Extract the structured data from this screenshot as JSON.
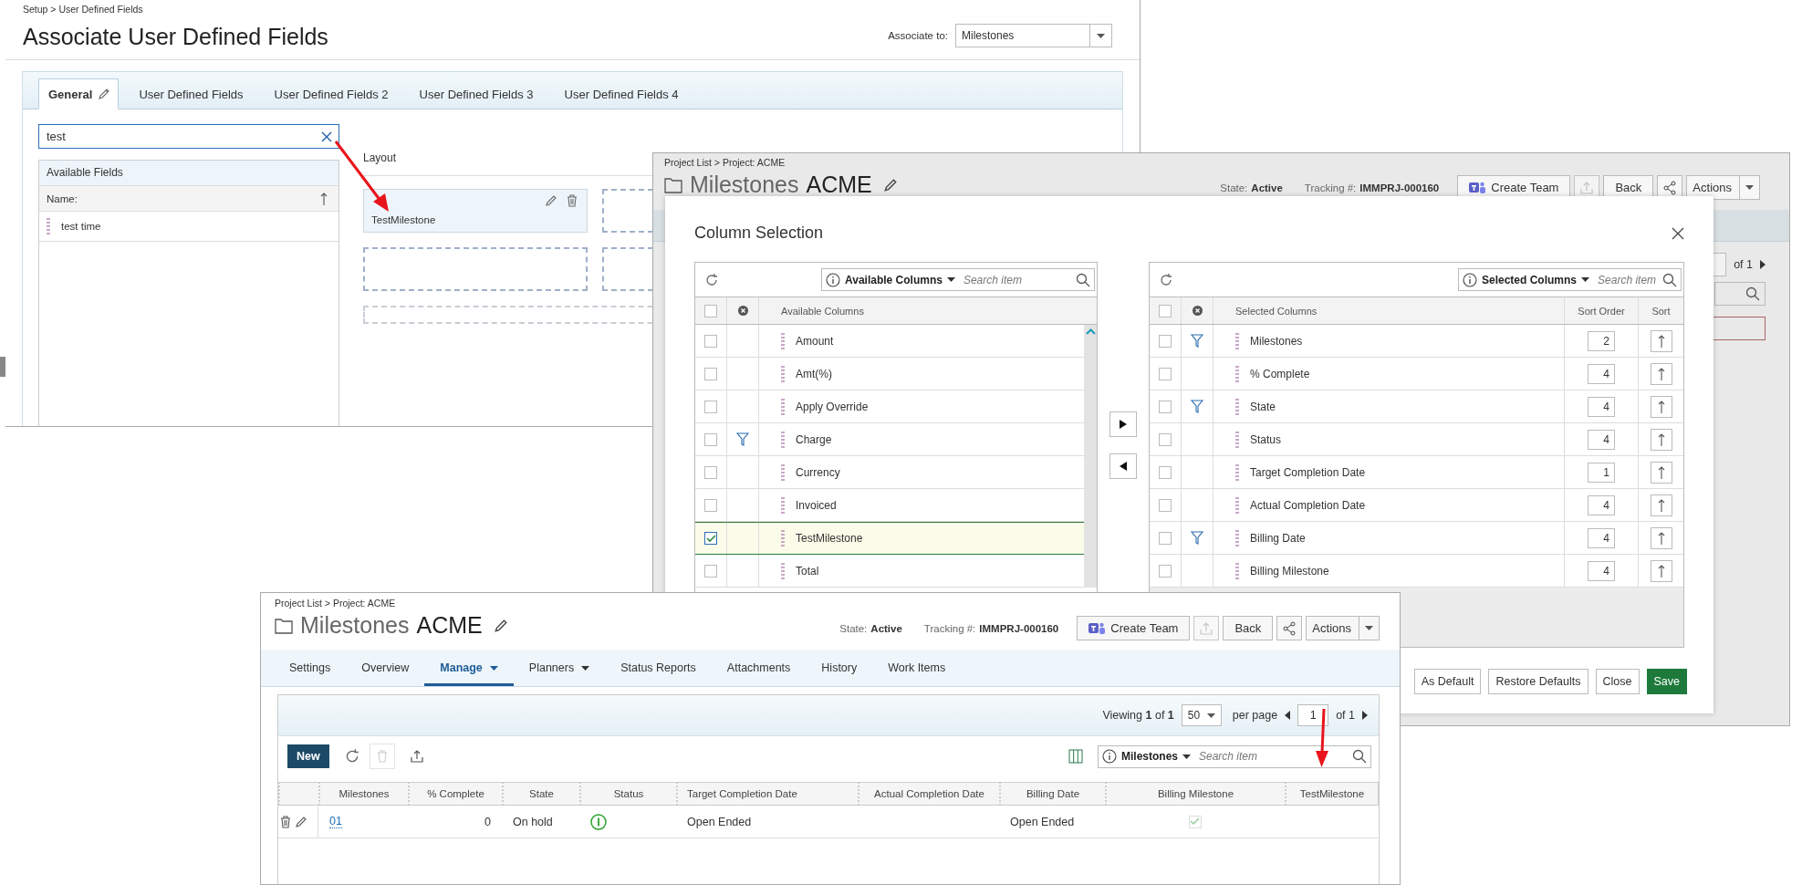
{
  "setup_page": {
    "breadcrumb": "Setup > User Defined Fields",
    "title": "Associate User Defined Fields",
    "associate_label": "Associate to:",
    "associate_value": "Milestones",
    "tabs": [
      {
        "label": "General",
        "selected": true
      },
      {
        "label": "User Defined Fields",
        "selected": false
      },
      {
        "label": "User Defined Fields 2",
        "selected": false
      },
      {
        "label": "User Defined Fields 3",
        "selected": false
      },
      {
        "label": "User Defined Fields 4",
        "selected": false
      }
    ],
    "search": {
      "value": "test"
    },
    "available_fields": {
      "title": "Available Fields",
      "column": "Name:",
      "items": [
        "test time"
      ]
    },
    "layout": {
      "title": "Layout",
      "fields": [
        "TestMilestone"
      ]
    }
  },
  "project_page_back": {
    "breadcrumb": "Project List > Project: ACME",
    "title": "Milestones",
    "project": "ACME",
    "state_label": "State:",
    "state": "Active",
    "tracking_label": "Tracking #:",
    "tracking": "IMMPRJ-000160",
    "create_team": "Create Team",
    "back": "Back",
    "actions": "Actions",
    "pager_of": "of 1"
  },
  "column_selection": {
    "title": "Column Selection",
    "available": {
      "dropdown": "Available Columns",
      "placeholder": "Search item",
      "header": "Available Columns",
      "all_checked": false,
      "rows": [
        {
          "name": "Amount",
          "checked": false,
          "filter": false
        },
        {
          "name": "Amt(%)",
          "checked": false,
          "filter": false
        },
        {
          "name": "Apply Override",
          "checked": false,
          "filter": false
        },
        {
          "name": "Charge",
          "checked": false,
          "filter": true
        },
        {
          "name": "Currency",
          "checked": false,
          "filter": false
        },
        {
          "name": "Invoiced",
          "checked": false,
          "filter": false
        },
        {
          "name": "TestMilestone",
          "checked": true,
          "filter": false
        },
        {
          "name": "Total",
          "checked": false,
          "filter": false
        }
      ]
    },
    "selected": {
      "dropdown": "Selected Columns",
      "placeholder": "Search item",
      "header": "Selected Columns",
      "all_checked": false,
      "sort_order_header": "Sort Order",
      "sort_header": "Sort",
      "rows": [
        {
          "name": "Milestones",
          "checked": false,
          "filter": true,
          "sort_order": "2"
        },
        {
          "name": "% Complete",
          "checked": false,
          "filter": false,
          "sort_order": "4"
        },
        {
          "name": "State",
          "checked": false,
          "filter": true,
          "sort_order": "4"
        },
        {
          "name": "Status",
          "checked": false,
          "filter": false,
          "sort_order": "4"
        },
        {
          "name": "Target Completion Date",
          "checked": false,
          "filter": false,
          "sort_order": "1"
        },
        {
          "name": "Actual Completion Date",
          "checked": false,
          "filter": false,
          "sort_order": "4"
        },
        {
          "name": "Billing Date",
          "checked": false,
          "filter": true,
          "sort_order": "4"
        },
        {
          "name": "Billing Milestone",
          "checked": false,
          "filter": false,
          "sort_order": "4"
        }
      ]
    },
    "buttons": [
      {
        "label": "As Default",
        "kind": "default"
      },
      {
        "label": "Restore Defaults",
        "kind": "default"
      },
      {
        "label": "Close",
        "kind": "default"
      },
      {
        "label": "Save",
        "kind": "primary"
      }
    ]
  },
  "project_page_front": {
    "breadcrumb": "Project List > Project: ACME",
    "title": "Milestones",
    "project": "ACME",
    "state_label": "State:",
    "state": "Active",
    "tracking_label": "Tracking #:",
    "tracking": "IMMPRJ-000160",
    "create_team": "Create Team",
    "back": "Back",
    "actions": "Actions",
    "tabs": [
      {
        "label": "Settings",
        "selected": false,
        "dropdown": false
      },
      {
        "label": "Overview",
        "selected": false,
        "dropdown": false
      },
      {
        "label": "Manage",
        "selected": true,
        "dropdown": true
      },
      {
        "label": "Planners",
        "selected": false,
        "dropdown": true
      },
      {
        "label": "Status Reports",
        "selected": false,
        "dropdown": false
      },
      {
        "label": "Attachments",
        "selected": false,
        "dropdown": false
      },
      {
        "label": "History",
        "selected": false,
        "dropdown": false
      },
      {
        "label": "Work Items",
        "selected": false,
        "dropdown": false
      }
    ],
    "pager": {
      "viewing": "Viewing **1** of **1**",
      "per_page_value": "50",
      "per_page_label": "per page",
      "page": "1",
      "page_of": "of 1"
    },
    "new_button": "New",
    "search_dropdown": "Milestones",
    "search_placeholder": "Search item",
    "columns": [
      "Milestones",
      "% Complete",
      "State",
      "Status",
      "Target Completion Date",
      "Actual Completion Date",
      "Billing Date",
      "Billing Milestone",
      "TestMilestone"
    ],
    "rows": [
      {
        "milestone": "01",
        "complete": "0",
        "state": "On hold",
        "target_completion": "Open Ended",
        "billing_date": "Open Ended",
        "billing_milestone": true
      }
    ]
  }
}
